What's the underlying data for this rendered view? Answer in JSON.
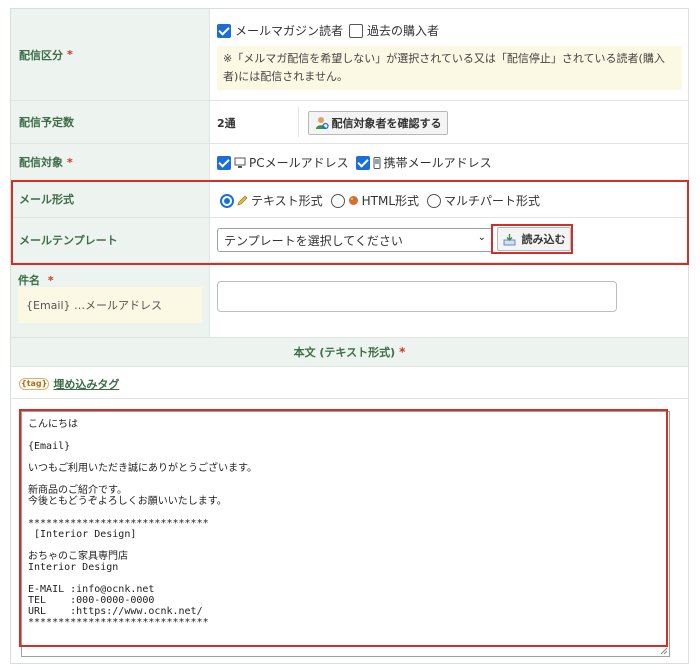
{
  "delivery_category": {
    "label": "配信区分",
    "required_mark": "*",
    "option_newsletter": "メールマガジン読者",
    "option_past_buyers": "過去の購入者",
    "note_line1": "※「メルマガ配信を希望しない」が選択されている又は「配信停止」されている読者(購入",
    "note_line2": "者)には配信されません。"
  },
  "scheduled_count": {
    "label": "配信予定数",
    "value": "2通",
    "confirm_button": "配信対象者を確認する"
  },
  "delivery_target": {
    "label": "配信対象",
    "required_mark": "*",
    "option_pc": "PCメールアドレス",
    "option_mobile": "携帯メールアドレス"
  },
  "mail_format": {
    "label": "メール形式",
    "option_text": "テキスト形式",
    "option_html": "HTML形式",
    "option_multipart": "マルチパート形式",
    "selected": "テキスト形式"
  },
  "mail_template": {
    "label": "メールテンプレート",
    "select_value": "テンプレートを選択してください",
    "load_button": "読み込む"
  },
  "subject": {
    "label": "件名",
    "required_mark": "*",
    "hint": "{Email} …メールアドレス",
    "value": ""
  },
  "body": {
    "heading": "本文 (テキスト形式)",
    "required_mark": "*",
    "embed_tag_icon": "{tag}",
    "embed_tag_link": "埋め込みタグ",
    "lines": [
      "こんにちは",
      "",
      "{Email}",
      "",
      "いつもご利用いただき誠にありがとうございます。",
      "",
      "新商品のご紹介です。",
      "今後ともどうぞよろしくお願いいたします。",
      "",
      "******************************",
      " [Interior Design]",
      "",
      "おちゃのこ家具専門店",
      "Interior Design",
      "",
      "E-MAIL :info@ocnk.net",
      "TEL    :000-0000-0000",
      "URL    :https://www.ocnk.net/",
      "******************************"
    ]
  },
  "colors": {
    "label_bg": "#edf3ef",
    "label_text": "#3c6e47",
    "required": "#d0302a",
    "highlight_border": "#d0302a",
    "checkbox_blue": "#1a6ed8",
    "note_bg": "#fbf8e3"
  }
}
